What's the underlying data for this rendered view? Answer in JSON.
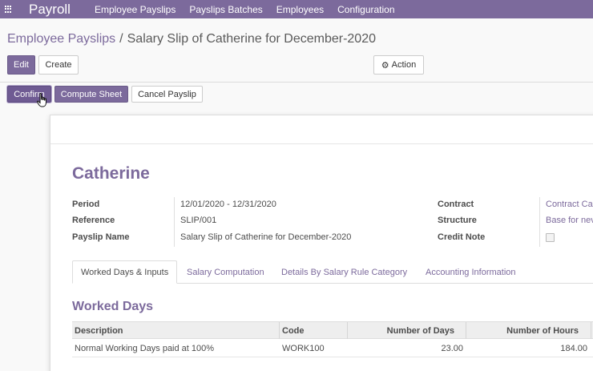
{
  "navbar": {
    "brand": "Payroll",
    "menu": [
      "Employee Payslips",
      "Payslips Batches",
      "Employees",
      "Configuration"
    ]
  },
  "breadcrumb": {
    "parent": "Employee Payslips",
    "separator": "/",
    "current": "Salary Slip of Catherine for December-2020"
  },
  "toolbar": {
    "edit": "Edit",
    "create": "Create",
    "action": "Action"
  },
  "statusbar": {
    "confirm": "Confirm",
    "compute": "Compute Sheet",
    "cancel": "Cancel Payslip"
  },
  "payslip": {
    "employee": "Catherine",
    "labels": {
      "period": "Period",
      "reference": "Reference",
      "name": "Payslip Name",
      "contract": "Contract",
      "structure": "Structure",
      "credit_note": "Credit Note"
    },
    "period": "12/01/2020 - 12/31/2020",
    "reference": "SLIP/001",
    "name": "Salary Slip of Catherine for December-2020",
    "contract": "Contract Ca",
    "structure": "Base for nev",
    "credit_note": false
  },
  "tabs": [
    "Worked Days & Inputs",
    "Salary Computation",
    "Details By Salary Rule Category",
    "Accounting Information"
  ],
  "worked_days": {
    "title": "Worked Days",
    "columns": [
      "Description",
      "Code",
      "Number of Days",
      "Number of Hours"
    ],
    "rows": [
      {
        "description": "Normal Working Days paid at 100%",
        "code": "WORK100",
        "days": "23.00",
        "hours": "184.00"
      }
    ]
  },
  "colors": {
    "brand": "#7c6a9c"
  }
}
